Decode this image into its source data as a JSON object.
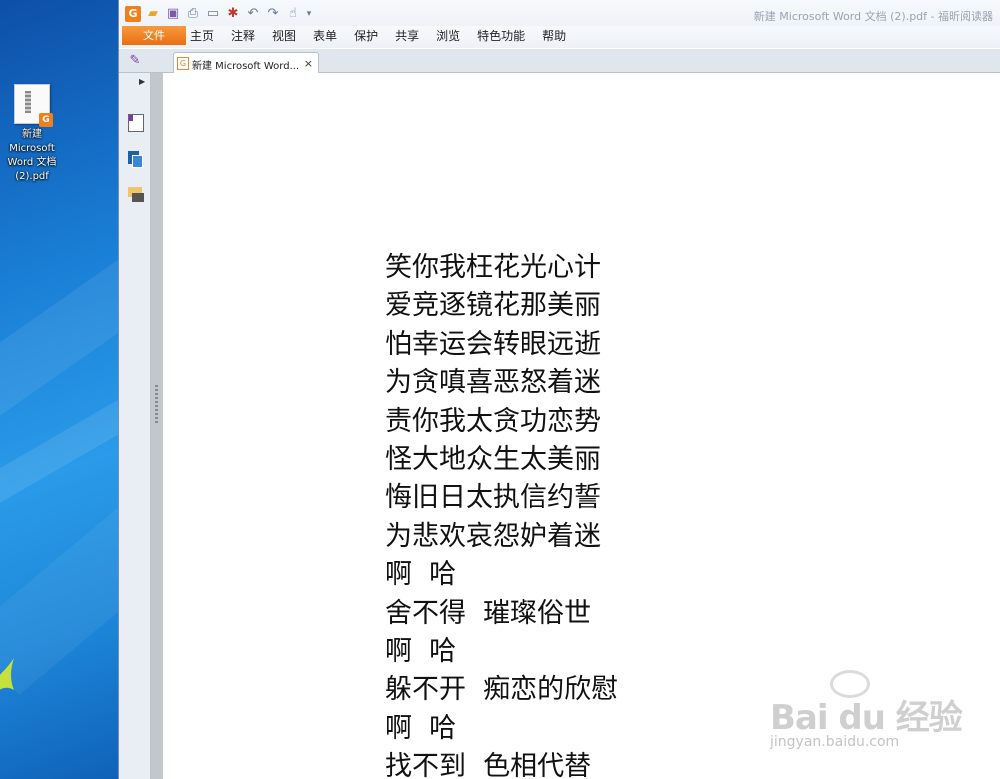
{
  "desktop": {
    "icon_label_lines": [
      "新建",
      "Microsoft",
      "Word 文档",
      "(2).pdf"
    ],
    "icon_badge": "G"
  },
  "window": {
    "title": "新建 Microsoft Word 文档 (2).pdf - 福昕阅读器",
    "qat_icons": [
      "foxit-logo-icon",
      "open-folder-icon",
      "save-icon",
      "print-icon",
      "scan-icon",
      "new-icon",
      "undo-icon",
      "redo-icon",
      "hand-tool-icon",
      "customize-icon"
    ]
  },
  "ribbon": {
    "file_label": "文件",
    "menu": [
      "主页",
      "注释",
      "视图",
      "表单",
      "保护",
      "共享",
      "浏览",
      "特色功能",
      "帮助"
    ]
  },
  "tabs": [
    {
      "label": "新建 Microsoft Word...",
      "close": "×"
    }
  ],
  "document": {
    "lines": [
      "笑你我枉花光心计",
      "爱竞逐镜花那美丽",
      "怕幸运会转眼远逝",
      "为贪嗔喜恶怒着迷",
      "责你我太贪功恋势",
      "怪大地众生太美丽",
      "悔旧日太执信约誓",
      "为悲欢哀怨妒着迷",
      "啊  哈",
      "舍不得  璀璨俗世",
      "啊  哈",
      "躲不开  痴恋的欣慰",
      "啊  哈",
      "找不到  色相代替"
    ]
  },
  "watermark": {
    "brand": "Bai du 经验",
    "url": "jingyan.baidu.com"
  },
  "colors": {
    "accent_orange": "#f07e1b",
    "desktop_blue": "#1a7fd6",
    "ribbon_bg": "#eef2f7"
  }
}
